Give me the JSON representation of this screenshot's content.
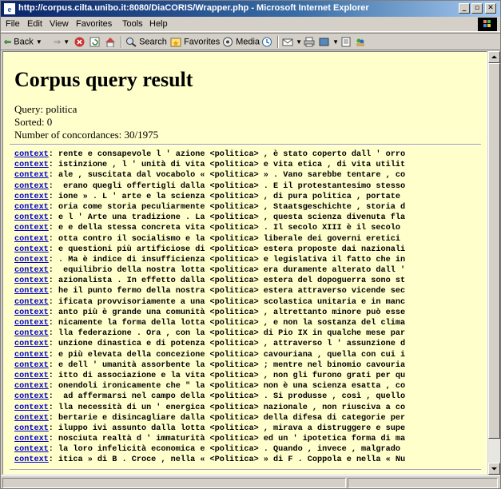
{
  "window": {
    "title": "http://corpus.cilta.unibo.it:8080/DiaCORIS/Wrapper.php - Microsoft Internet Explorer"
  },
  "menubar": [
    "File",
    "Edit",
    "View",
    "Favorites",
    "Tools",
    "Help"
  ],
  "toolbar": {
    "back": "Back",
    "search": "Search",
    "favorites": "Favorites",
    "media": "Media"
  },
  "page": {
    "title": "Corpus query result",
    "query": "Query: politica",
    "sorted": "Sorted: 0",
    "count": "Number of concordances: 30/1975"
  },
  "link_label": "context",
  "concordances": [
    ": rente e consapevole l ' azione <politica> , è stato coperto dall ' orro",
    ": istinzione , l ' unità di vita <politica> e vita etica , di vita utilit",
    ": ale , suscitata dal vocabolo « <politica> » . Vano sarebbe tentare , co",
    ":  erano quegli offertigli dalla <politica> . E il protestantesimo stesso",
    ": ione » . L ' arte e la scienza <politica> , di pura politica , portate ",
    ": oria come storia peculiarmente <politica> , Staatsgeschichte , storia d",
    ": e l ' Arte una tradizione . La <politica> , questa scienza divenuta fla",
    ": e e della stessa concreta vita <politica> . Il secolo XIII è il secolo ",
    ": otta contro il socialismo e la <politica> liberale dei governi eretici ",
    ": e questioni più artificiose di <politica> estera proposte dai nazionali",
    ": . Ma è indice di insufficienza <politica> e legislativa il fatto che in",
    ":  equilibrio della nostra lotta <politica> era duramente alterato dall '",
    ": azionalista . In effetto dalla <politica> estera del dopoguerra sono st",
    ": he il punto fermo della nostra <politica> estera attraverso vicende sec",
    ": ificata provvisoriamente a una <politica> scolastica unitaria e in manc",
    ": anto più è grande una comunità <politica> , altrettanto minore può esse",
    ": nicamente la forma della lotta <politica> , e non la sostanza del clima",
    ": lla federazione . Ora , con la <politica> di Pio IX in qualche mese par",
    ": unzione dinastica e di potenza <politica> , attraverso l ' assunzione d",
    ": e più elevata della concezione <politica> cavouriana , quella con cui i",
    ": e dell ' umanità assorbente la <politica> ; mentre nel binomio cavouria",
    ": itto di associazione e la vita <politica> , non gli furono grati per qu",
    ": onendoli ironicamente che \" la <politica> non è una scienza esatta , co",
    ":  ad affermarsi nel campo della <politica> . Si produsse , così , quello",
    ": lla necessità di un ' energica <politica> nazionale , non riusciva a co",
    ": bertarie e disincagliare dalla <politica> della difesa di categorie per",
    ": iluppo ivi assunto dalla lotta <politica> , mirava a distruggere e supe",
    ": nosciuta realtà d ' immaturità <politica> ed un ' ipotetica forma di ma",
    ": la loro infelicità economica e <politica> . Quando , invece , malgrado ",
    ": itica » di B . Croce , nella « <Politica> » di F . Coppola e nella « Nu"
  ]
}
